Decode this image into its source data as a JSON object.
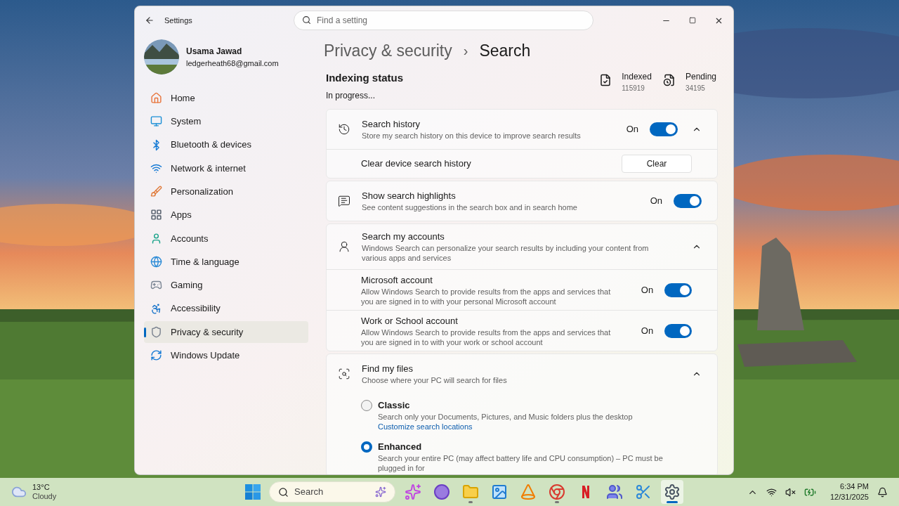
{
  "window": {
    "title": "Settings"
  },
  "search": {
    "placeholder": "Find a setting"
  },
  "user": {
    "name": "Usama Jawad",
    "email": "ledgerheath68@gmail.com"
  },
  "nav": [
    {
      "label": "Home",
      "selected": false
    },
    {
      "label": "System",
      "selected": false
    },
    {
      "label": "Bluetooth & devices",
      "selected": false
    },
    {
      "label": "Network & internet",
      "selected": false
    },
    {
      "label": "Personalization",
      "selected": false
    },
    {
      "label": "Apps",
      "selected": false
    },
    {
      "label": "Accounts",
      "selected": false
    },
    {
      "label": "Time & language",
      "selected": false
    },
    {
      "label": "Gaming",
      "selected": false
    },
    {
      "label": "Accessibility",
      "selected": false
    },
    {
      "label": "Privacy & security",
      "selected": true
    },
    {
      "label": "Windows Update",
      "selected": false
    }
  ],
  "breadcrumb": {
    "parent": "Privacy & security",
    "separator": "›",
    "current": "Search"
  },
  "indexing": {
    "title": "Indexing status",
    "status": "In progress...",
    "stats": [
      {
        "label": "Indexed",
        "value": "115919"
      },
      {
        "label": "Pending",
        "value": "34195"
      }
    ]
  },
  "sections": [
    {
      "kind": "toggle_group",
      "title": "Search history",
      "description": "Store my search history on this device to improve search results",
      "state_label": "On",
      "on": true,
      "expanded": true,
      "children": [
        {
          "kind": "button",
          "title": "Clear device search history",
          "button": "Clear"
        }
      ]
    },
    {
      "kind": "toggle",
      "title": "Show search highlights",
      "description": "See content suggestions in the search box and in search home",
      "state_label": "On",
      "on": true
    },
    {
      "kind": "group",
      "title": "Search my accounts",
      "description": "Windows Search can personalize your search results by including your content from various apps and services",
      "expanded": true,
      "children": [
        {
          "kind": "toggle",
          "title": "Microsoft account",
          "description": "Allow Windows Search to provide results from the apps and services that you are signed in to with your personal Microsoft account",
          "state_label": "On",
          "on": true
        },
        {
          "kind": "toggle",
          "title": "Work or School account",
          "description": "Allow Windows Search to provide results from the apps and services that you are signed in to with your work or school account",
          "state_label": "On",
          "on": true
        }
      ]
    },
    {
      "kind": "group",
      "title": "Find my files",
      "description": "Choose where your PC will search for files",
      "expanded": true,
      "children": [
        {
          "kind": "radio",
          "title": "Classic",
          "description": "Search only your Documents, Pictures, and Music folders plus the desktop",
          "link": "Customize search locations",
          "selected": false
        },
        {
          "kind": "radio",
          "title": "Enhanced",
          "description": "Search your entire PC (may affect battery life and CPU consumption) – PC must be plugged in for",
          "selected": true
        }
      ]
    }
  ],
  "taskbar": {
    "weather": {
      "temp": "13°C",
      "condition": "Cloudy"
    },
    "search_placeholder": "Search",
    "apps": [
      {
        "running": false,
        "selected": false
      },
      {
        "running": false,
        "selected": false
      },
      {
        "running": false,
        "selected": false
      },
      {
        "running": true,
        "selected": false
      },
      {
        "running": false,
        "selected": false
      },
      {
        "running": false,
        "selected": false
      },
      {
        "running": true,
        "selected": false
      },
      {
        "running": false,
        "selected": false
      },
      {
        "running": false,
        "selected": false
      },
      {
        "running": false,
        "selected": false
      },
      {
        "running": true,
        "selected": true
      }
    ],
    "time": "6:34 PM",
    "date": "12/31/2025"
  }
}
